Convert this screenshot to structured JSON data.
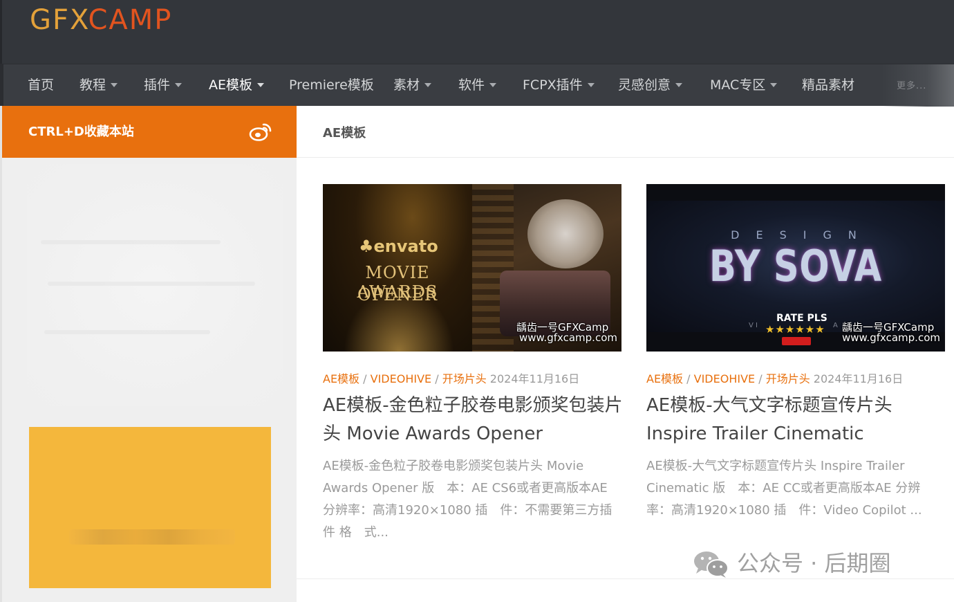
{
  "brand": {
    "logo_part1": "GFX",
    "logo_part2": "CAMP",
    "colors": {
      "logo_gold": "#e3a13a",
      "logo_orange": "#e2541f",
      "accent": "#e8700e",
      "header_bg": "#33363b"
    }
  },
  "nav": {
    "items": [
      {
        "label": "首页",
        "dropdown": false
      },
      {
        "label": "教程",
        "dropdown": true
      },
      {
        "label": "插件",
        "dropdown": true
      },
      {
        "label": "AE模板",
        "dropdown": true,
        "active": true
      },
      {
        "label": "Premiere模板",
        "dropdown": false
      },
      {
        "label": "素材",
        "dropdown": true
      },
      {
        "label": "软件",
        "dropdown": true
      },
      {
        "label": "FCPX插件",
        "dropdown": true
      },
      {
        "label": "灵感创意",
        "dropdown": true
      },
      {
        "label": "MAC专区",
        "dropdown": true
      },
      {
        "label": "精品素材",
        "dropdown": false
      }
    ],
    "overflow_text": "更多..."
  },
  "sidebar": {
    "bookmark_text": "CTRL+D收藏本站",
    "social_icon": "weibo-icon"
  },
  "main": {
    "page_title": "AE模板",
    "posts": [
      {
        "categories": [
          "AE模板",
          "VIDEOHIVE",
          "开场片头"
        ],
        "date": "2024年11月16日",
        "title": "AE模板-金色粒子胶卷电影颁奖包装片头 Movie Awards Opener",
        "excerpt": "AE模板-金色粒子胶卷电影颁奖包装片头 Movie Awards Opener 版　本：AE CS6或者更高版本AE 分辨率：高清1920×1080 插　件：不需要第三方插件 格　式...",
        "thumb": {
          "brand": "envato",
          "line1": "MOVIE AWARDS",
          "line2": "OPENER",
          "watermark1": "龋齿一号GFXCamp",
          "watermark2": "www.gfxcamp.com"
        }
      },
      {
        "categories": [
          "AE模板",
          "VIDEOHIVE",
          "开场片头"
        ],
        "date": "2024年11月16日",
        "title": "AE模板-大气文字标题宣传片头 Inspire Trailer Cinematic",
        "excerpt": "AE模板-大气文字标题宣传片头 Inspire Trailer Cinematic 版　本：AE CC或者更高版本AE 分辨率：高清1920×1080 插　件：Video Copilot ...",
        "thumb": {
          "line1": "DESIGN",
          "line2": "BY SOVA",
          "rate": "RATE PLS",
          "stars": "★★★★★★",
          "watermark1": "龋齿一号GFXCamp",
          "watermark2": "www.gfxcamp.com"
        }
      }
    ]
  },
  "watermark": {
    "text": "公众号 · 后期圈"
  }
}
